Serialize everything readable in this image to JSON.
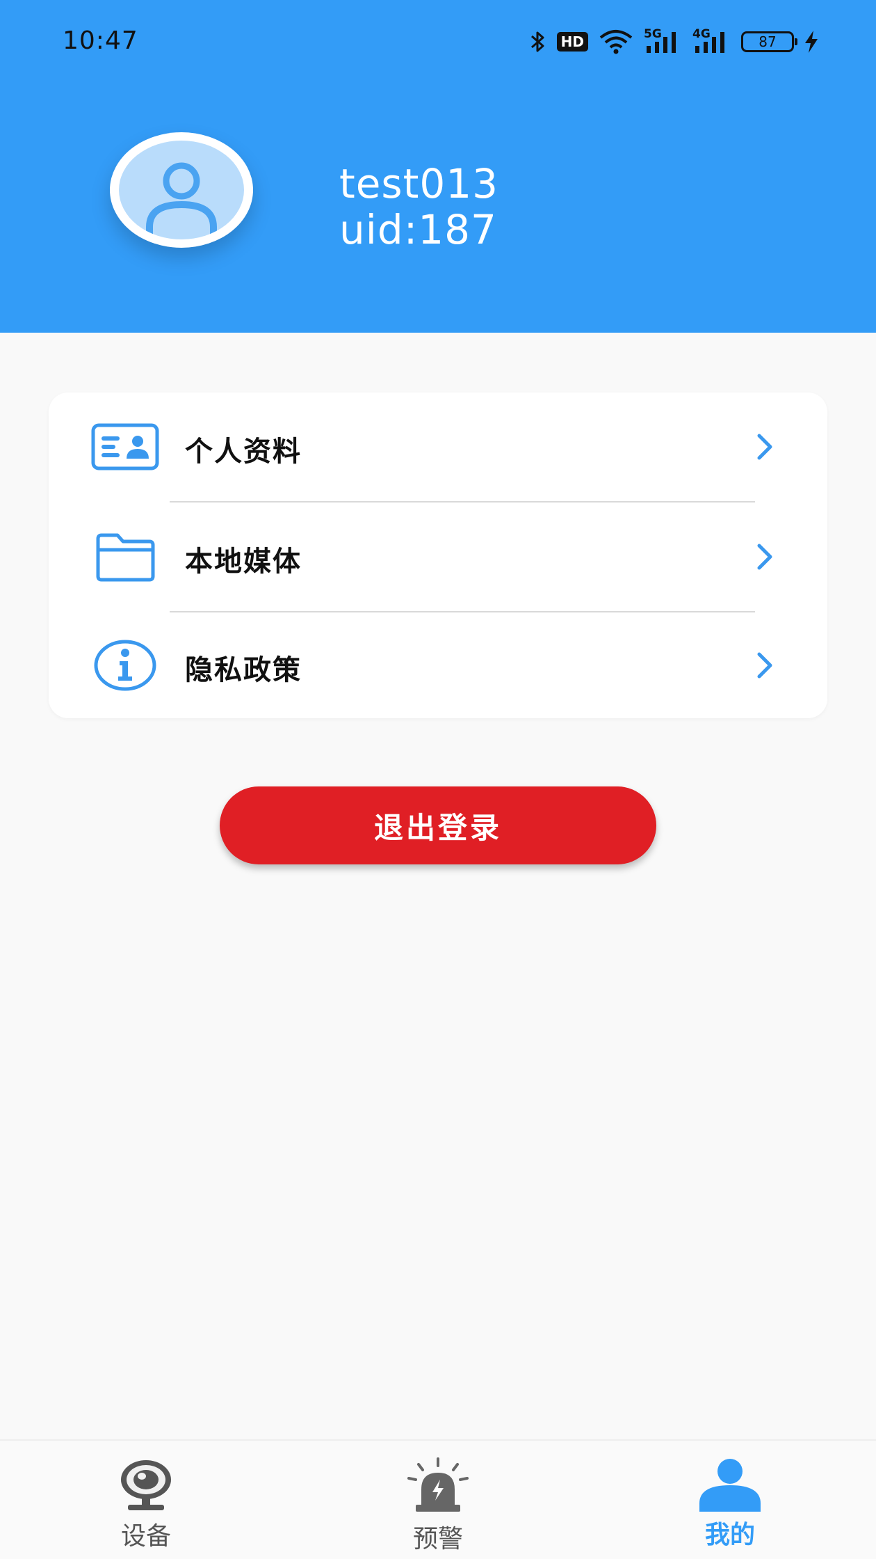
{
  "status_bar": {
    "time": "10:47",
    "battery": "87",
    "network_5g": "5G",
    "network_4g": "4G",
    "hd": "HD"
  },
  "profile": {
    "username": "test013",
    "uid": "uid:187"
  },
  "menu": {
    "items": [
      {
        "label": "个人资料",
        "icon": "id-card-icon"
      },
      {
        "label": "本地媒体",
        "icon": "folder-icon"
      },
      {
        "label": "隐私政策",
        "icon": "info-icon"
      }
    ]
  },
  "logout": {
    "label": "退出登录"
  },
  "bottom_nav": {
    "items": [
      {
        "label": "设备",
        "icon": "camera-icon",
        "active": false
      },
      {
        "label": "预警",
        "icon": "alarm-icon",
        "active": false
      },
      {
        "label": "我的",
        "icon": "person-icon",
        "active": true
      }
    ]
  },
  "colors": {
    "accent": "#339cf7",
    "danger": "#e01f25",
    "background": "#f9f9f9"
  }
}
